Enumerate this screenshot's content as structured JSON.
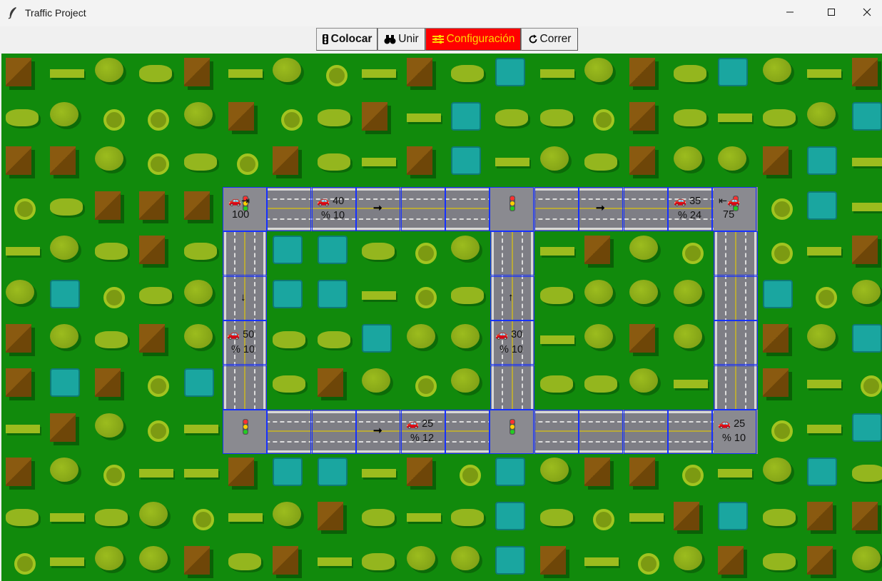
{
  "window": {
    "title": "Traffic Project"
  },
  "toolbar": {
    "colocar": "Colocar",
    "unir": "Unir",
    "configuracion": "Configuración",
    "correr": "Correr",
    "active_color": "#ff0000",
    "active_text_color": "#ffd700"
  },
  "map": {
    "grass_color": "#118a0c",
    "grid_color": "#1630ff",
    "entry_label": "100",
    "exit_label": "75",
    "segments": [
      {
        "cars": "40",
        "percent": "% 10"
      },
      {
        "cars": "35",
        "percent": "% 24"
      },
      {
        "cars": "50",
        "percent": "% 10"
      },
      {
        "cars": "30",
        "percent": "% 10"
      },
      {
        "cars": "25",
        "percent": "% 12"
      },
      {
        "cars": "25",
        "percent": "% 10"
      }
    ]
  }
}
